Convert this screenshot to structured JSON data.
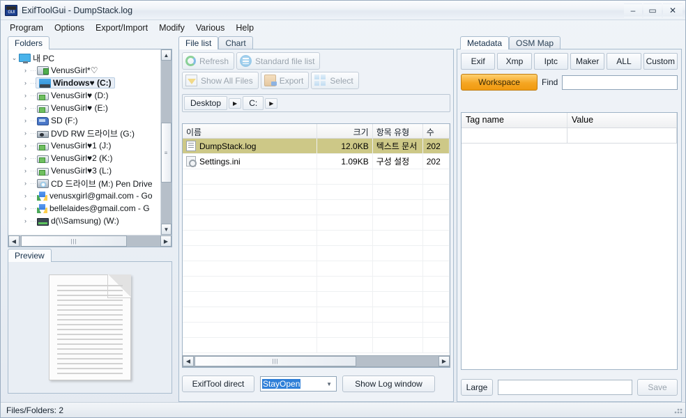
{
  "window": {
    "title": "ExifToolGui - DumpStack.log",
    "icon_label": "GUI",
    "minimize": "–",
    "maximize": "▭",
    "close": "✕"
  },
  "menu": [
    "Program",
    "Options",
    "Export/Import",
    "Modify",
    "Various",
    "Help"
  ],
  "left": {
    "folders_tab": "Folders",
    "preview_tab": "Preview",
    "tree": [
      {
        "label": "내 PC",
        "icon": "monitor-icon",
        "twist": "⌄",
        "indent": 0,
        "selected": false
      },
      {
        "label": "VenusGirl*♡",
        "icon": "usb-drive-icon",
        "twist": "›",
        "indent": 1,
        "selected": false
      },
      {
        "label": "Windows♥ (C:)",
        "icon": "windows-drive-icon",
        "twist": "›",
        "indent": 1,
        "selected": true
      },
      {
        "label": "VenusGirl♥ (D:)",
        "icon": "drive-icon",
        "twist": "›",
        "indent": 1,
        "selected": false
      },
      {
        "label": "VenusGirl♥ (E:)",
        "icon": "drive-icon",
        "twist": "›",
        "indent": 1,
        "selected": false
      },
      {
        "label": "SD (F:)",
        "icon": "sd-card-icon",
        "twist": "›",
        "indent": 1,
        "selected": false
      },
      {
        "label": "DVD RW 드라이브 (G:)",
        "icon": "dvd-drive-icon",
        "twist": "›",
        "indent": 1,
        "selected": false
      },
      {
        "label": "VenusGirl♥1 (J:)",
        "icon": "drive-icon",
        "twist": "›",
        "indent": 1,
        "selected": false
      },
      {
        "label": "VenusGirl♥2 (K:)",
        "icon": "drive-icon",
        "twist": "›",
        "indent": 1,
        "selected": false
      },
      {
        "label": "VenusGirl♥3 (L:)",
        "icon": "drive-icon",
        "twist": "›",
        "indent": 1,
        "selected": false
      },
      {
        "label": "CD 드라이브 (M:) Pen Drive",
        "icon": "cd-drive-icon",
        "twist": "›",
        "indent": 1,
        "selected": false
      },
      {
        "label": "venusxgirl@gmail.com - Go",
        "icon": "google-drive-icon",
        "twist": "›",
        "indent": 1,
        "selected": false
      },
      {
        "label": "bellelaides@gmail.com - G",
        "icon": "google-drive-icon",
        "twist": "›",
        "indent": 1,
        "selected": false
      },
      {
        "label": "d(\\\\Samsung) (W:)",
        "icon": "network-drive-icon",
        "twist": "›",
        "indent": 1,
        "selected": false
      }
    ]
  },
  "center": {
    "tabs": [
      {
        "label": "File list",
        "active": true
      },
      {
        "label": "Chart",
        "active": false
      }
    ],
    "toolbar": [
      {
        "label": "Refresh",
        "icon": "refresh-icon",
        "enabled": false
      },
      {
        "label": "Standard file list",
        "icon": "list-icon",
        "enabled": false
      },
      {
        "label": "Show All Files",
        "icon": "filter-icon",
        "enabled": false
      },
      {
        "label": "Export",
        "icon": "export-icon",
        "enabled": false
      },
      {
        "label": "Select",
        "icon": "select-icon",
        "enabled": false
      }
    ],
    "breadcrumb": [
      "Desktop",
      "▶",
      "C:",
      "▶"
    ],
    "columns": [
      "이름",
      "크기",
      "항목 유형",
      "수"
    ],
    "rows": [
      {
        "name": "DumpStack.log",
        "size": "12.0KB",
        "type": "텍스트 문서",
        "date": "202",
        "icon": "text-file-icon",
        "selected": true
      },
      {
        "name": "Settings.ini",
        "size": "1.09KB",
        "type": "구성 설정",
        "date": "202",
        "icon": "ini-file-icon",
        "selected": false
      }
    ],
    "bottom": {
      "exiftool_direct": "ExifTool direct",
      "mode_value": "StayOpen",
      "show_log": "Show Log window"
    }
  },
  "right": {
    "tabs": [
      {
        "label": "Metadata",
        "active": true
      },
      {
        "label": "OSM Map",
        "active": false
      }
    ],
    "group_tabs": [
      "Exif",
      "Xmp",
      "Iptc",
      "Maker",
      "ALL",
      "Custom"
    ],
    "workspace": "Workspace",
    "find_label": "Find",
    "find_value": "",
    "columns": [
      "Tag name",
      "Value"
    ],
    "bottom": {
      "large": "Large",
      "input_value": "",
      "save": "Save"
    }
  },
  "status": {
    "text": "Files/Folders: 2"
  }
}
